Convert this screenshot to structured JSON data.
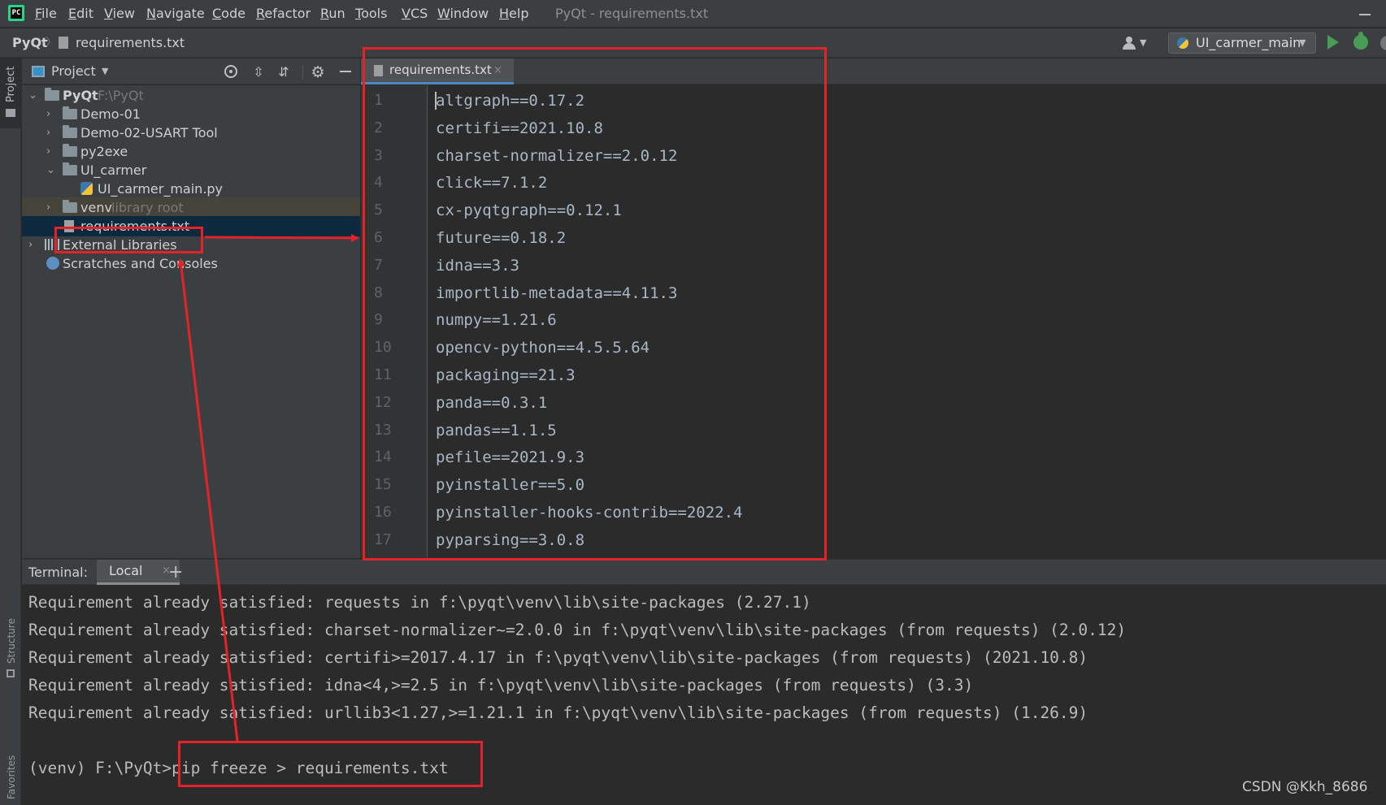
{
  "menubar": {
    "items": [
      "File",
      "Edit",
      "View",
      "Navigate",
      "Code",
      "Refactor",
      "Run",
      "Tools",
      "VCS",
      "Window",
      "Help"
    ],
    "window_title": "PyQt - requirements.txt",
    "logo_text": "PC"
  },
  "navbar": {
    "project": "PyQt",
    "separator": "〉",
    "file": "requirements.txt",
    "run_config": "UI_carmer_main",
    "caret": "▼"
  },
  "left_stripe": {
    "project": "Project",
    "structure": "Structure",
    "favorites": "Favorites"
  },
  "project_panel": {
    "title": "Project",
    "caret": "▼",
    "expand_glyph": "⇳",
    "collapse_glyph": "⇵",
    "settings_glyph": "⚙",
    "tree": [
      {
        "arrow": "⌄",
        "label": "PyQt",
        "hint": "F:\\PyQt"
      },
      {
        "arrow": "›",
        "label": "Demo-01",
        "hint": ""
      },
      {
        "arrow": "›",
        "label": "Demo-02-USART Tool",
        "hint": ""
      },
      {
        "arrow": "›",
        "label": "py2exe",
        "hint": ""
      },
      {
        "arrow": "⌄",
        "label": "UI_carmer",
        "hint": ""
      },
      {
        "arrow": "",
        "label": "UI_carmer_main.py",
        "hint": ""
      },
      {
        "arrow": "›",
        "label": "venv",
        "hint": "library root"
      },
      {
        "arrow": "",
        "label": "requirements.txt",
        "hint": ""
      },
      {
        "arrow": "›",
        "label": "External Libraries",
        "hint": ""
      },
      {
        "arrow": "",
        "label": "Scratches and Consoles",
        "hint": ""
      }
    ]
  },
  "editor": {
    "tab_label": "requirements.txt",
    "tab_close": "×",
    "line_numbers": [
      "1",
      "2",
      "3",
      "4",
      "5",
      "6",
      "7",
      "8",
      "9",
      "10",
      "11",
      "12",
      "13",
      "14",
      "15",
      "16",
      "17"
    ],
    "lines": [
      "altgraph==0.17.2",
      "certifi==2021.10.8",
      "charset-normalizer==2.0.12",
      "click==7.1.2",
      "cx-pyqtgraph==0.12.1",
      "future==0.18.2",
      "idna==3.3",
      "importlib-metadata==4.11.3",
      "numpy==1.21.6",
      "opencv-python==4.5.5.64",
      "packaging==21.3",
      "panda==0.3.1",
      "pandas==1.1.5",
      "pefile==2021.9.3",
      "pyinstaller==5.0",
      "pyinstaller-hooks-contrib==2022.4",
      "pyparsing==3.0.8"
    ]
  },
  "terminal": {
    "title": "Terminal:",
    "tab_label": "Local",
    "tab_close": "×",
    "add": "+",
    "lines": [
      "Requirement already satisfied: requests in f:\\pyqt\\venv\\lib\\site-packages (2.27.1)",
      "Requirement already satisfied: charset-normalizer~=2.0.0 in f:\\pyqt\\venv\\lib\\site-packages (from requests) (2.0.12)",
      "Requirement already satisfied: certifi>=2017.4.17 in f:\\pyqt\\venv\\lib\\site-packages (from requests) (2021.10.8)",
      "Requirement already satisfied: idna<4,>=2.5 in f:\\pyqt\\venv\\lib\\site-packages (from requests) (3.3)",
      "Requirement already satisfied: urllib3<1.27,>=1.21.1 in f:\\pyqt\\venv\\lib\\site-packages (from requests) (1.26.9)"
    ],
    "prompt": "(venv) F:\\PyQt>pip freeze > requirements.txt"
  },
  "watermark": "CSDN @Kkh_8686",
  "colors": {
    "annotation": "#e5222a",
    "run": "#499c54",
    "selection": "#0d293e"
  }
}
